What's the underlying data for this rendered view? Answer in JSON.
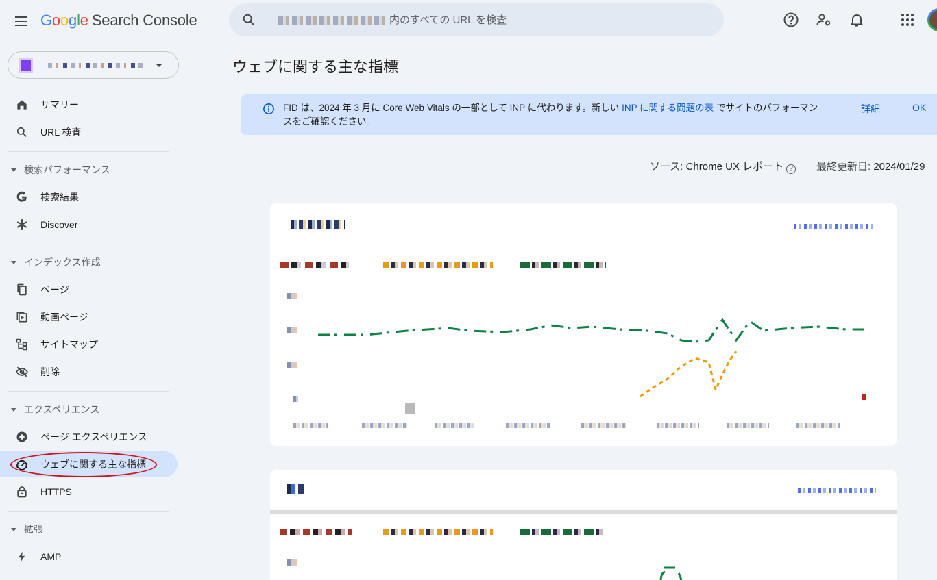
{
  "app": {
    "logo_parts": [
      "G",
      "o",
      "o",
      "g",
      "l",
      "e"
    ],
    "product": "Search Console"
  },
  "search": {
    "placeholder": "内のすべての URL を検査"
  },
  "topbar_icons": [
    "help-icon",
    "manage-users-icon",
    "notifications-icon",
    "apps-grid-icon",
    "account-avatar"
  ],
  "sidebar": {
    "items": [
      {
        "label": "サマリー",
        "icon": "home-icon"
      },
      {
        "label": "URL 検査",
        "icon": "search-icon"
      },
      {
        "label": "検索パフォーマンス",
        "type": "section"
      },
      {
        "label": "検索結果",
        "icon": "google-g-icon"
      },
      {
        "label": "Discover",
        "icon": "asterisk-icon"
      },
      {
        "label": "インデックス作成",
        "type": "section"
      },
      {
        "label": "ページ",
        "icon": "pages-icon"
      },
      {
        "label": "動画ページ",
        "icon": "video-icon"
      },
      {
        "label": "サイトマップ",
        "icon": "sitemap-icon"
      },
      {
        "label": "削除",
        "icon": "visibility-off-icon"
      },
      {
        "label": "エクスペリエンス",
        "type": "section"
      },
      {
        "label": "ページ エクスペリエンス",
        "icon": "add-circle-icon"
      },
      {
        "label": "ウェブに関する主な指標",
        "icon": "speed-gauge-icon",
        "active": true
      },
      {
        "label": "HTTPS",
        "icon": "lock-icon"
      },
      {
        "label": "拡張",
        "type": "section"
      },
      {
        "label": "AMP",
        "icon": "bolt-icon"
      }
    ]
  },
  "main": {
    "title": "ウェブに関する主な指標",
    "banner": {
      "text_before": "FID は、2024 年 3 月に Core Web Vitals の一部として INP に代わります。新しい ",
      "link": "INP に関する問題の表",
      "text_after": " でサイトのパフォーマンスをご確認ください。",
      "details_button": "詳細",
      "ok_button": "OK"
    },
    "source_label": "ソース:",
    "source_value": "Chrome UX レポート",
    "updated_label": "最終更新日:",
    "updated_value": "2024/01/29"
  },
  "colors": {
    "accent": "#0b57d0",
    "active_nav": "#d3e3fd",
    "good": "#0d8043",
    "needs_improvement": "#f29900",
    "poor": "#c5221f",
    "annotation": "#d4141c"
  }
}
